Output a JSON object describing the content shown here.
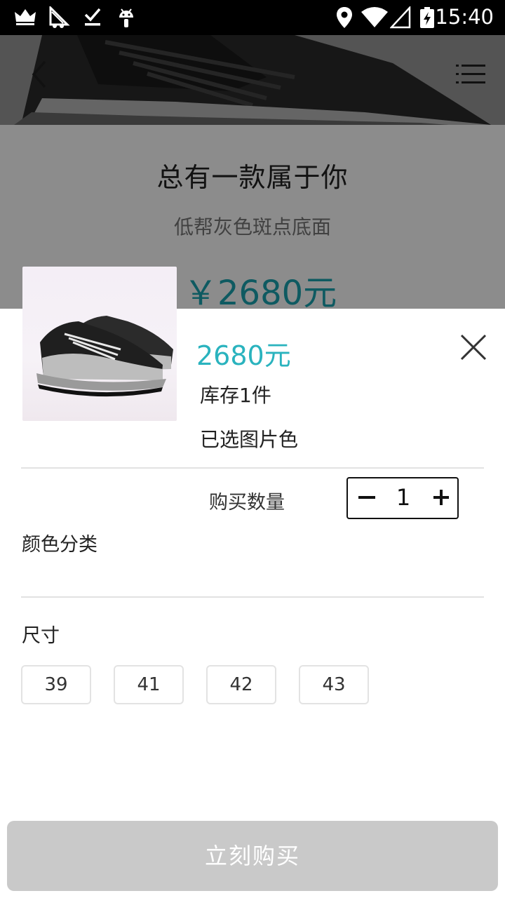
{
  "status_bar": {
    "time": "15:40",
    "icons": [
      "crown-icon",
      "sailboat-icon",
      "download-done-icon",
      "android-icon",
      "location-icon",
      "wifi-icon",
      "signal-icon",
      "battery-charging-icon"
    ]
  },
  "product": {
    "title": "总有一款属于你",
    "subtitle": "低帮灰色斑点底面",
    "price": "￥2680元"
  },
  "sheet": {
    "price": "2680元",
    "stock": "库存1件",
    "selected": "已选图片色",
    "quantity_label": "购买数量",
    "quantity_value": "1",
    "color_label": "颜色分类",
    "size_label": "尺寸",
    "sizes": [
      "39",
      "41",
      "42",
      "43"
    ],
    "buy_label": "立刻购买"
  },
  "colors": {
    "accent": "#2ab3be",
    "buy_disabled": "#c9c9c9"
  }
}
